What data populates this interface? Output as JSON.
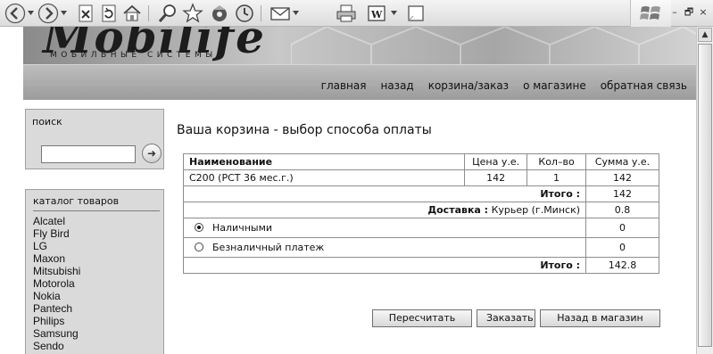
{
  "browser": {
    "toolbar_icons": [
      "back-icon",
      "forward-icon",
      "stop-icon",
      "refresh-icon",
      "home-icon",
      "search-icon",
      "favorites-icon",
      "media-icon",
      "history-icon",
      "mail-icon",
      "print-icon",
      "edit-icon",
      "discuss-icon"
    ],
    "window_controls": [
      "–",
      "🗗",
      "×"
    ]
  },
  "site": {
    "logo_text": "Mobilife",
    "logo_subtitle": "МОБИЛЬНЫЕ СИСТЕМЫ",
    "nav": [
      {
        "label": "главная"
      },
      {
        "label": "назад"
      },
      {
        "label": "корзина/заказ"
      },
      {
        "label": "о магазине"
      },
      {
        "label": "обратная связь"
      }
    ]
  },
  "search": {
    "title": "поиск",
    "value": "",
    "go_icon": "arrow-right-icon"
  },
  "catalog": {
    "title": "каталог товаров",
    "items": [
      "Alcatel",
      "Fly Bird",
      "LG",
      "Maxon",
      "Mitsubishi",
      "Motorola",
      "Nokia",
      "Pantech",
      "Philips",
      "Samsung",
      "Sendo"
    ]
  },
  "cart": {
    "title": "Ваша корзина - выбор способа оплаты",
    "headers": {
      "name": "Наименование",
      "price": "Цена у.е.",
      "qty": "Кол–во",
      "sum": "Сумма у.е."
    },
    "items": [
      {
        "name": "C200 (РСТ 36 мес.г.)",
        "price": "142",
        "qty": "1",
        "sum": "142"
      }
    ],
    "subtotal_label": "Итого :",
    "subtotal_value": "142",
    "delivery_label": "Доставка :",
    "delivery_method": "Курьер (г.Минск)",
    "delivery_value": "0.8",
    "payments": [
      {
        "label": "Наличными",
        "value": "0",
        "selected": true
      },
      {
        "label": "Безналичный платеж",
        "value": "0",
        "selected": false
      }
    ],
    "total_label": "Итого :",
    "total_value": "142.8"
  },
  "buttons": {
    "recalc": "Пересчитать",
    "order": "Заказать",
    "back_to_shop": "Назад в магазин"
  }
}
